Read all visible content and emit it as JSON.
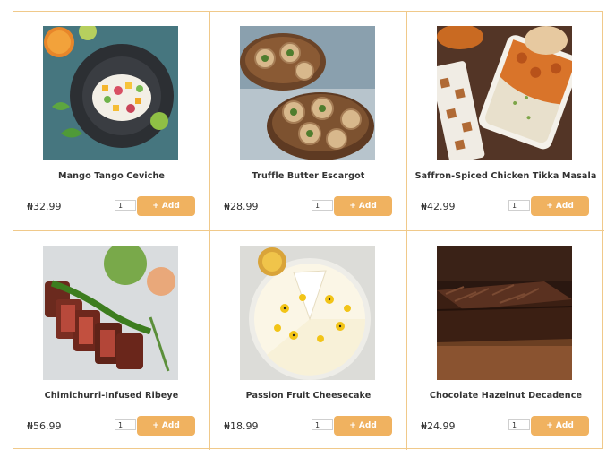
{
  "products": [
    {
      "name": "Mango Tango Ceviche",
      "price": "₦32.99",
      "qty": "1",
      "add_label": "+ Add",
      "image": "ceviche-photo"
    },
    {
      "name": "Truffle Butter Escargot",
      "price": "₦28.99",
      "qty": "1",
      "add_label": "+ Add",
      "image": "escargot-photo"
    },
    {
      "name": "Saffron-Spiced Chicken Tikka Masala",
      "price": "₦42.99",
      "qty": "1",
      "add_label": "+ Add",
      "image": "tikka-masala-photo"
    },
    {
      "name": "Chimichurri-Infused Ribeye",
      "price": "₦56.99",
      "qty": "1",
      "add_label": "+ Add",
      "image": "ribeye-photo"
    },
    {
      "name": "Passion Fruit Cheesecake",
      "price": "₦18.99",
      "qty": "1",
      "add_label": "+ Add",
      "image": "cheesecake-photo"
    },
    {
      "name": "Chocolate Hazelnut Decadence",
      "price": "₦24.99",
      "qty": "1",
      "add_label": "+ Add",
      "image": "chocolate-cake-photo"
    }
  ],
  "colors": {
    "accent": "#f0b260",
    "border": "#f0c98a",
    "text": "#333333"
  }
}
